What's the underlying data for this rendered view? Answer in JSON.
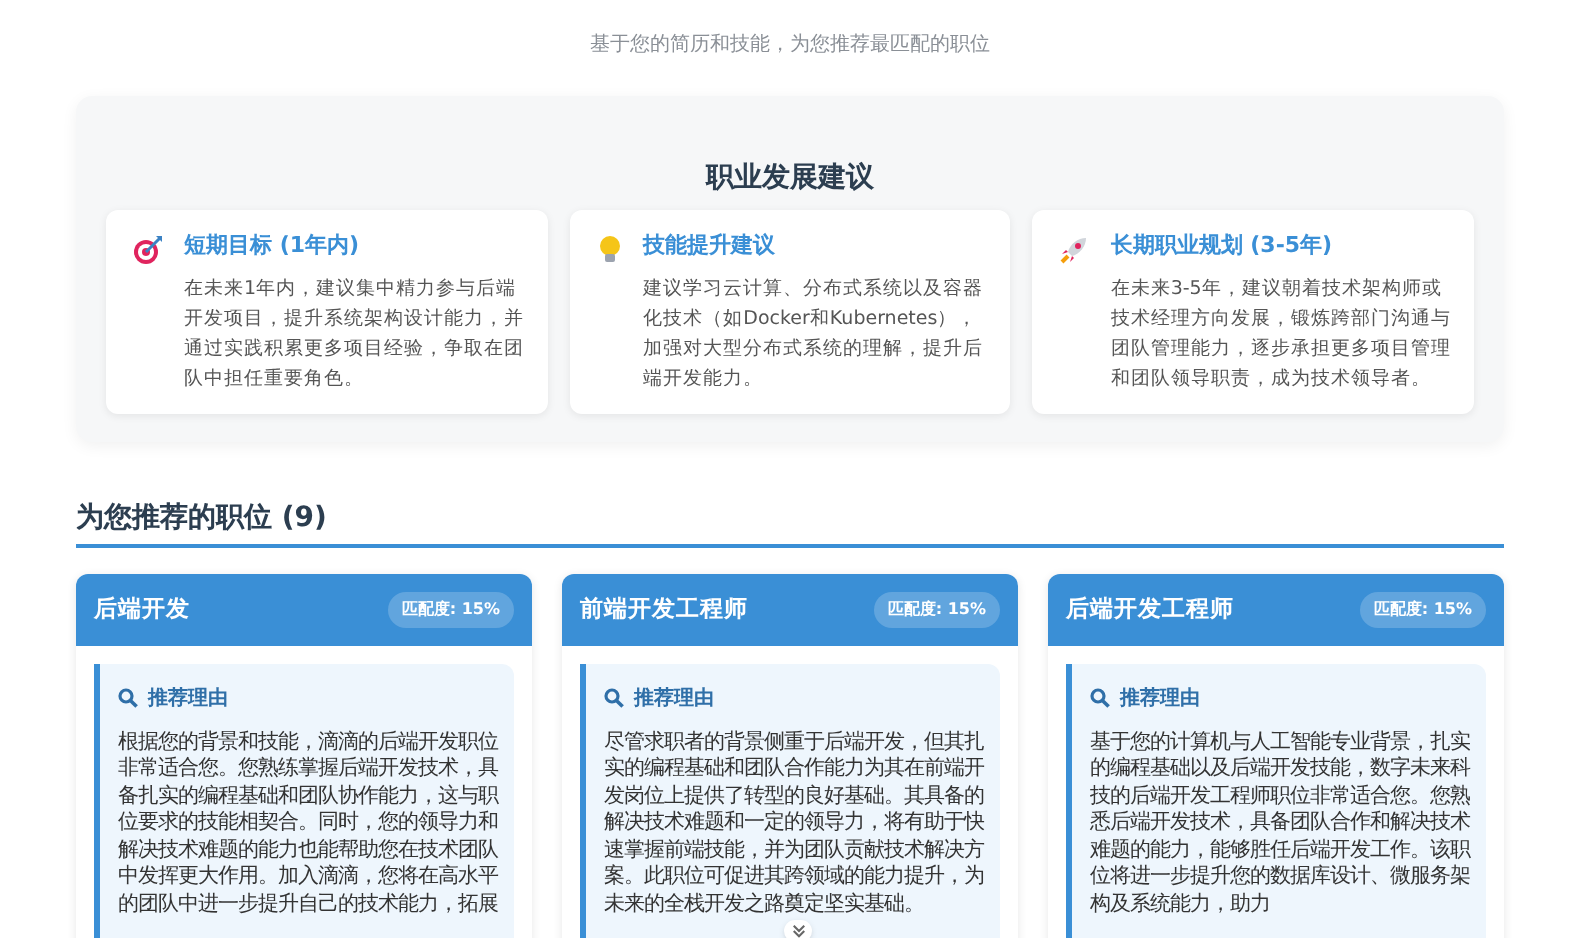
{
  "subtitle": "基于您的简历和技能，为您推荐最匹配的职位",
  "advice": {
    "title": "职业发展建议",
    "items": [
      {
        "kind": "target",
        "title": "短期目标 (1年内)",
        "text": "在未来1年内，建议集中精力参与后端开发项目，提升系统架构设计能力，并通过实践积累更多项目经验，争取在团队中担任重要角色。"
      },
      {
        "kind": "bulb",
        "title": "技能提升建议",
        "text": "建议学习云计算、分布式系统以及容器化技术（如Docker和Kubernetes），加强对大型分布式系统的理解，提升后端开发能力。"
      },
      {
        "kind": "rocket",
        "title": "长期职业规划 (3-5年)",
        "text": "在未来3-5年，建议朝着技术架构师或技术经理方向发展，锻炼跨部门沟通与团队管理能力，逐步承担更多项目管理和团队领导职责，成为技术领导者。"
      }
    ]
  },
  "jobs": {
    "heading": "为您推荐的职位 (9)",
    "items": [
      {
        "title": "后端开发",
        "match": "匹配度: 15%",
        "reason_label": "推荐理由",
        "reason": "根据您的背景和技能，滴滴的后端开发职位非常适合您。您熟练掌握后端开发技术，具备扎实的编程基础和团队协作能力，这与职位要求的技能相契合。同时，您的领导力和解决技术难题的能力也能帮助您在技术团队中发挥更大作用。加入滴滴，您将在高水平的团队中进一步提升自己的技术能力，拓展",
        "expand_button": false
      },
      {
        "title": "前端开发工程师",
        "match": "匹配度: 15%",
        "reason_label": "推荐理由",
        "reason": "尽管求职者的背景侧重于后端开发，但其扎实的编程基础和团队合作能力为其在前端开发岗位上提供了转型的良好基础。其具备的解决技术难题和一定的领导力，将有助于快速掌握前端技能，并为团队贡献技术解决方案。此职位可促进其跨领域的能力提升，为未来的全栈开发之路奠定坚实基础。",
        "expand_button": true
      },
      {
        "title": "后端开发工程师",
        "match": "匹配度: 15%",
        "reason_label": "推荐理由",
        "reason": "基于您的计算机与人工智能专业背景，扎实的编程基础以及后端开发技能，数字未来科技的后端开发工程师职位非常适合您。您熟悉后端开发技术，具备团队合作和解决技术难题的能力，能够胜任后端开发工作。该职位将进一步提升您的数据库设计、微服务架构及系统能力，助力",
        "expand_button": false
      }
    ]
  }
}
